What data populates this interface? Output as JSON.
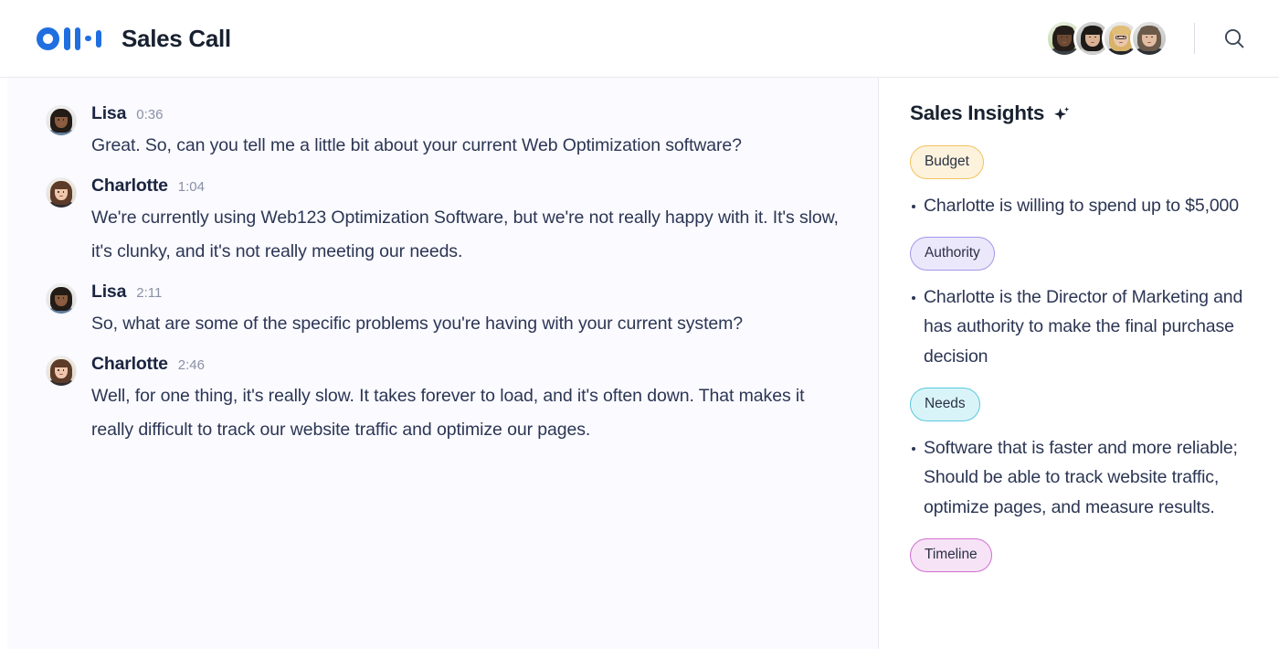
{
  "header": {
    "logo_name": "otter-logo",
    "title": "Sales Call",
    "search_icon": "search-icon",
    "participants": [
      {
        "name": "participant-1"
      },
      {
        "name": "participant-2"
      },
      {
        "name": "participant-3"
      },
      {
        "name": "participant-4"
      }
    ]
  },
  "transcript": {
    "messages": [
      {
        "speaker": "Lisa",
        "time": "0:36",
        "text": "Great. So, can you tell me a little bit about your current Web Optimization software?"
      },
      {
        "speaker": "Charlotte",
        "time": "1:04",
        "text": "We're currently using Web123 Optimization Software, but we're not really happy with it. It's slow, it's clunky, and it's not really meeting our needs."
      },
      {
        "speaker": "Lisa",
        "time": "2:11",
        "text": "So, what are some of the specific problems you're having with your current system?"
      },
      {
        "speaker": "Charlotte",
        "time": "2:46",
        "text": "Well, for one thing, it's really slow. It takes forever to load, and it's often down. That makes it really difficult to track our website traffic and optimize our pages."
      }
    ]
  },
  "insights": {
    "title": "Sales Insights",
    "sparkle_icon": "sparkle-icon",
    "groups": [
      {
        "label": "Budget",
        "color": "#f3c25e",
        "bg": "#fdf3dc",
        "bullets": [
          "Charlotte is willing to spend up to $5,000"
        ]
      },
      {
        "label": "Authority",
        "color": "#a397ea",
        "bg": "#ece8fb",
        "bullets": [
          "Charlotte is the Director of Marketing and has authority to make the final purchase decision"
        ]
      },
      {
        "label": "Needs",
        "color": "#57c8dd",
        "bg": "#d9f4f8",
        "bullets": [
          "Software that is faster and more reliable; Should be able to track website traffic, optimize pages, and measure results."
        ]
      },
      {
        "label": "Timeline",
        "color": "#cf6fd0",
        "bg": "#f7e3f6",
        "bullets": []
      }
    ]
  },
  "colors": {
    "brand_blue": "#1f6fe0",
    "text_dark": "#18212f",
    "text_body": "#2c3654",
    "text_muted": "#8a90a3",
    "panel_tint": "#fafaff"
  }
}
